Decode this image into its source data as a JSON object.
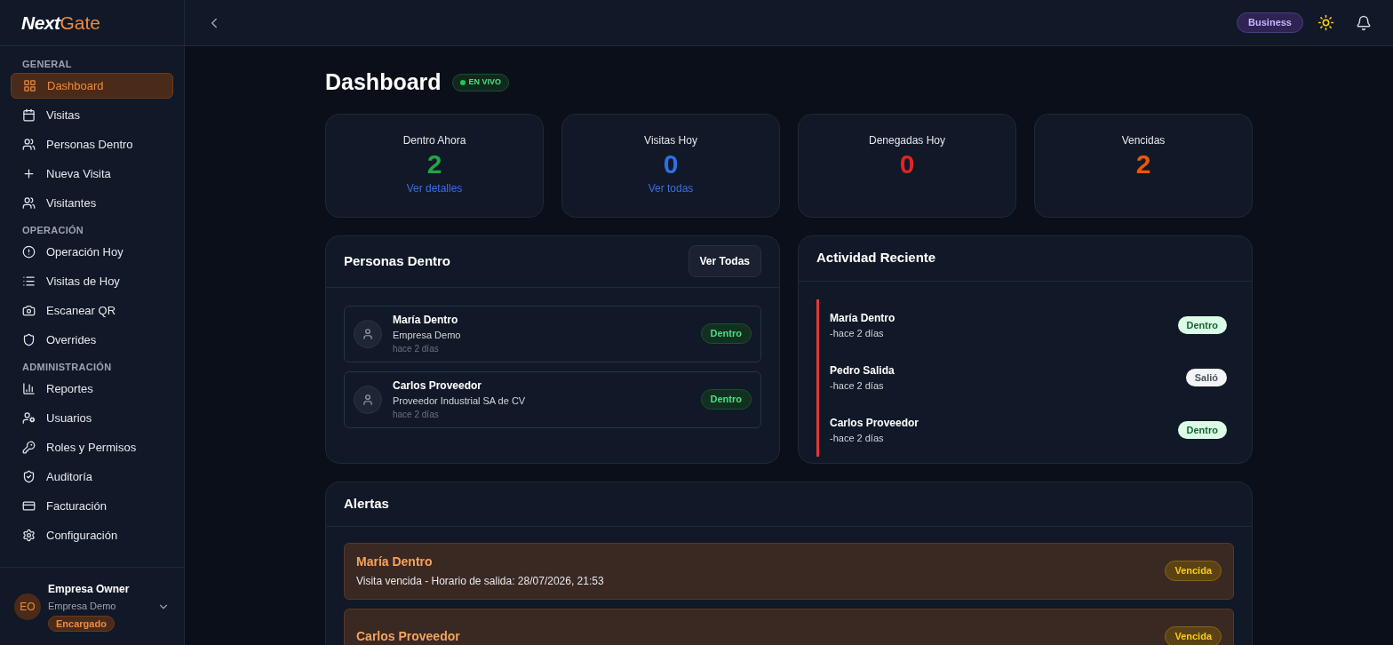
{
  "brand": {
    "bold": "Next",
    "light": "Gate"
  },
  "topbar": {
    "plan": "Business"
  },
  "sidebar": {
    "sections": [
      {
        "title": "GENERAL",
        "items": [
          {
            "label": "Dashboard",
            "selected": true
          },
          {
            "label": "Visitas",
            "selected": false
          },
          {
            "label": "Personas Dentro",
            "selected": false
          },
          {
            "label": "Nueva Visita",
            "selected": false
          },
          {
            "label": "Visitantes",
            "selected": false
          }
        ]
      },
      {
        "title": "OPERACIÓN",
        "items": [
          {
            "label": "Operación Hoy",
            "selected": false
          },
          {
            "label": "Visitas de Hoy",
            "selected": false
          },
          {
            "label": "Escanear QR",
            "selected": false
          },
          {
            "label": "Overrides",
            "selected": false
          }
        ]
      },
      {
        "title": "ADMINISTRACIÓN",
        "items": [
          {
            "label": "Reportes",
            "selected": false
          },
          {
            "label": "Usuarios",
            "selected": false
          },
          {
            "label": "Roles y Permisos",
            "selected": false
          },
          {
            "label": "Auditoría",
            "selected": false
          },
          {
            "label": "Facturación",
            "selected": false
          },
          {
            "label": "Configuración",
            "selected": false
          }
        ]
      }
    ],
    "user": {
      "initials": "EO",
      "name": "Empresa Owner",
      "company": "Empresa Demo",
      "role": "Encargado"
    }
  },
  "page": {
    "title": "Dashboard",
    "live_badge": "EN VIVO"
  },
  "stats": [
    {
      "label": "Dentro Ahora",
      "value": "2",
      "color": "#22a447",
      "link": "Ver detalles"
    },
    {
      "label": "Visitas Hoy",
      "value": "0",
      "color": "#2f6fe4",
      "link": "Ver todas"
    },
    {
      "label": "Denegadas Hoy",
      "value": "0",
      "color": "#dc2626"
    },
    {
      "label": "Vencidas",
      "value": "2",
      "color": "#ea580c"
    }
  ],
  "people_inside": {
    "title": "Personas Dentro",
    "button": "Ver Todas",
    "rows": [
      {
        "name": "María Dentro",
        "company": "Empresa Demo",
        "time": "hace 2 días",
        "status": "Dentro"
      },
      {
        "name": "Carlos Proveedor",
        "company": "Proveedor Industrial SA de CV",
        "time": "hace 2 días",
        "status": "Dentro"
      }
    ]
  },
  "recent_activity": {
    "title": "Actividad Reciente",
    "rows": [
      {
        "name": "María Dentro",
        "time": "-hace 2 días",
        "status": "Dentro",
        "kind": "in"
      },
      {
        "name": "Pedro Salida",
        "time": "-hace 2 días",
        "status": "Salió",
        "kind": "out"
      },
      {
        "name": "Carlos Proveedor",
        "time": "-hace 2 días",
        "status": "Dentro",
        "kind": "in"
      }
    ]
  },
  "alerts": {
    "title": "Alertas",
    "rows": [
      {
        "name": "María Dentro",
        "detail": "Visita vencida - Horario de salida: 28/07/2026, 21:53",
        "badge": "Vencida"
      },
      {
        "name": "Carlos Proveedor",
        "badge": "Vencida"
      }
    ]
  }
}
